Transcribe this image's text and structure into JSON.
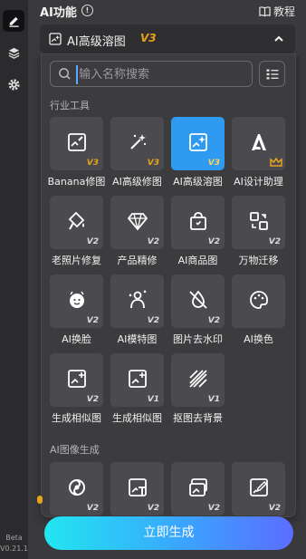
{
  "rail": {
    "items": [
      {
        "icon": "pencil-icon",
        "active": true
      },
      {
        "icon": "layers-icon",
        "active": false
      },
      {
        "icon": "gear-icon",
        "active": false
      }
    ],
    "beta_label": "Beta",
    "version": "V0.21.1"
  },
  "header": {
    "title": "AI功能",
    "info_glyph": "!",
    "tutorial_label": "教程"
  },
  "selector": {
    "label": "AI高级溶图",
    "version": "V3"
  },
  "search": {
    "placeholder": "输入名称搜索"
  },
  "sections": [
    {
      "title": "行业工具",
      "items": [
        {
          "label": "Banana修图",
          "version": "V3",
          "icon": "image-edit-icon",
          "selected": false
        },
        {
          "label": "AI高级修图",
          "version": "V3",
          "icon": "magic-wand-icon",
          "selected": false
        },
        {
          "label": "AI高级溶图",
          "version": "V3",
          "icon": "image-sparkle-icon",
          "selected": true
        },
        {
          "label": "AI设计助理",
          "version": "",
          "icon": "ai-letter-icon",
          "selected": false,
          "badge": "crown-icon"
        },
        {
          "label": "老照片修复",
          "version": "V2",
          "icon": "brush-bucket-icon",
          "selected": false
        },
        {
          "label": "产品精修",
          "version": "V2",
          "icon": "diamond-icon",
          "selected": false
        },
        {
          "label": "AI商品图",
          "version": "V2",
          "icon": "shopping-bag-icon",
          "selected": false
        },
        {
          "label": "万物迁移",
          "version": "V2",
          "icon": "transfer-icon",
          "selected": false
        },
        {
          "label": "AI换脸",
          "version": "V2",
          "icon": "face-icon",
          "selected": false
        },
        {
          "label": "AI模特图",
          "version": "V2",
          "icon": "model-person-icon",
          "selected": false
        },
        {
          "label": "图片去水印",
          "version": "V2",
          "icon": "watermark-remove-icon",
          "selected": false
        },
        {
          "label": "AI换色",
          "version": "",
          "icon": "color-palette-icon",
          "selected": false
        },
        {
          "label": "生成相似图",
          "version": "V2",
          "icon": "image-plus-icon",
          "selected": false
        },
        {
          "label": "生成相似图",
          "version": "V1",
          "icon": "image-plus-icon",
          "selected": false
        },
        {
          "label": "抠图去背景",
          "version": "V1",
          "icon": "stripes-icon",
          "selected": false
        }
      ]
    },
    {
      "title": "AI图像生成",
      "items": [
        {
          "label": "",
          "version": "V2",
          "icon": "swirl-icon",
          "selected": false
        },
        {
          "label": "",
          "version": "V2",
          "icon": "text-image-icon",
          "selected": false
        },
        {
          "label": "",
          "version": "V2",
          "icon": "image-swap-icon",
          "selected": false
        },
        {
          "label": "",
          "version": "V2",
          "icon": "image-edit-box-icon",
          "selected": false
        }
      ]
    }
  ],
  "generate_button": {
    "label": "立即生成"
  },
  "colors": {
    "accent_blue": "#2e9bf0",
    "version_gold": "#e8a21d",
    "generate_gradient_start": "#22e6f0",
    "generate_gradient_end": "#5b6dff"
  }
}
